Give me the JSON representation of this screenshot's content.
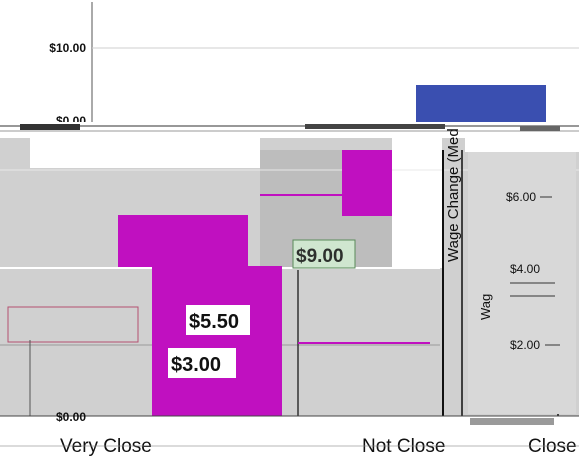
{
  "colors": {
    "magenta": "#c010c0",
    "blue": "#3a4fb0",
    "panel_gray": "#d0d0d0",
    "panel_gray_dark": "#bdbdbd",
    "white": "#ffffff"
  },
  "chart_data": [
    {
      "type": "bar",
      "title": "",
      "ylabel": "",
      "yticks": [
        "$10.00",
        "$0.00"
      ],
      "categories": [],
      "series": [
        {
          "values": [
            5.0
          ]
        }
      ],
      "color": "#3a4fb0"
    },
    {
      "type": "bar",
      "title": "",
      "ylabel": "",
      "yticks": [
        "$0.00"
      ],
      "categories": [
        "Very Close",
        "Not Close"
      ],
      "series": [
        {
          "values": [
            5.5,
            3.0
          ]
        }
      ],
      "data_labels": [
        "$5.50",
        "$3.00",
        "$9.00"
      ],
      "color": "#c010c0"
    },
    {
      "type": "bar",
      "title": "",
      "ylabel": "Wage Change (Med",
      "yticks": [
        "$6.00",
        "$4.00",
        "$2.00"
      ],
      "categories": [
        "Close"
      ],
      "series": [
        {
          "values": []
        }
      ]
    }
  ]
}
